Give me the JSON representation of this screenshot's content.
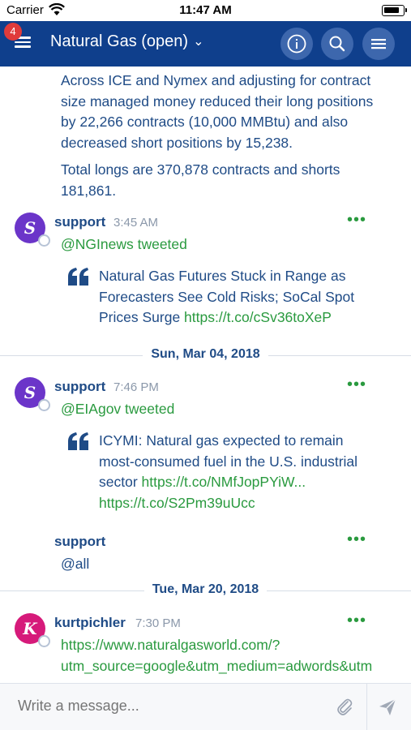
{
  "status_bar": {
    "carrier": "Carrier",
    "time": "11:47 AM"
  },
  "header": {
    "badge": "4",
    "title": "Natural Gas (open)"
  },
  "intro": {
    "p1": [
      "Across ICE and Nymex and adjusting for contract",
      "size managed money reduced their long positions",
      "by 22,266 contracts (10,000 MMBtu) and also",
      "decreased short positions by 15,238."
    ],
    "p2": [
      "Total longs are 370,878 contracts and shorts",
      "181,861."
    ]
  },
  "messages": [
    {
      "avatar": "S",
      "avatar_color": "#6b35c9",
      "author": "support",
      "time": "3:45 AM",
      "line": "@NGInews tweeted",
      "quote": [
        "Natural Gas Futures Stuck in Range as",
        "Forecasters See Cold Risks; SoCal Spot"
      ],
      "quote_last_text": "Prices Surge ",
      "quote_last_link": "https://t.co/cSv36toXeP"
    },
    {
      "avatar": "S",
      "avatar_color": "#6b35c9",
      "author": "support",
      "time": "7:46 PM",
      "line": "@EIAgov tweeted",
      "quote": [
        "ICYMI: Natural gas expected to remain",
        "most-consumed fuel in the U.S. industrial"
      ],
      "quote_last_text": "sector ",
      "quote_last_link": "https://t.co/NMfJopPYiW...",
      "quote_extra_link": "https://t.co/S2Pm39uUcc"
    },
    {
      "author": "support",
      "body": "@all"
    },
    {
      "avatar": "K",
      "avatar_color": "#d61a7a",
      "author": "kurtpichler",
      "time": "7:30 PM",
      "link_lines": [
        "https://www.naturalgasworld.com/?",
        "utm_source=google&utm_medium=adwords&utm"
      ]
    }
  ],
  "dividers": [
    "Sun, Mar 04, 2018",
    "Tue, Mar 20, 2018"
  ],
  "composer": {
    "placeholder": "Write a message..."
  },
  "colors": {
    "nav": "#0f3f8c",
    "link": "#2a9a3f",
    "text": "#1f4b86"
  }
}
